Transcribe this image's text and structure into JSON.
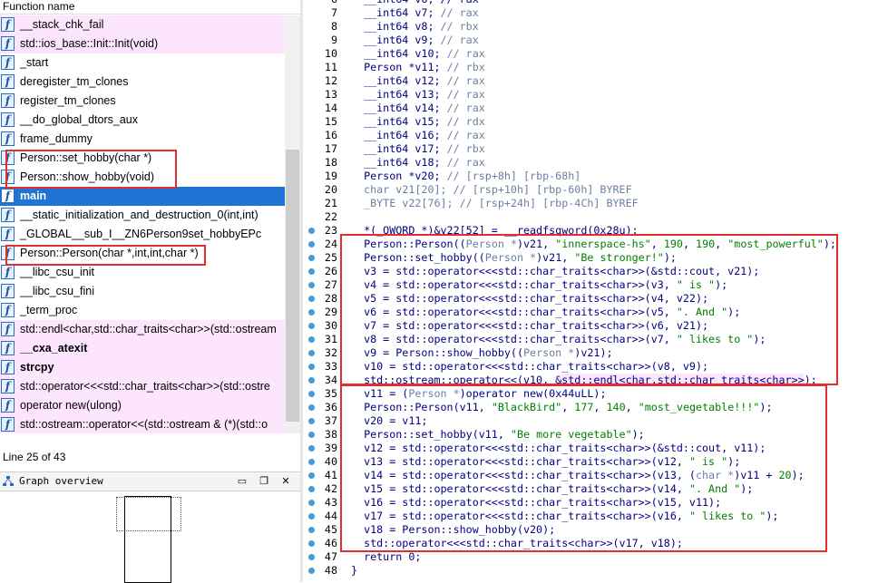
{
  "left_pane": {
    "header": "Function name",
    "functions": [
      {
        "label": "__stack_chk_fail",
        "style": "pink"
      },
      {
        "label": "std::ios_base::Init::Init(void)",
        "style": "pink"
      },
      {
        "label": "_start",
        "style": "normal"
      },
      {
        "label": "deregister_tm_clones",
        "style": "normal"
      },
      {
        "label": "register_tm_clones",
        "style": "normal"
      },
      {
        "label": "__do_global_dtors_aux",
        "style": "normal"
      },
      {
        "label": "frame_dummy",
        "style": "normal"
      },
      {
        "label": "Person::set_hobby(char *)",
        "style": "normal"
      },
      {
        "label": "Person::show_hobby(void)",
        "style": "normal"
      },
      {
        "label": "main",
        "style": "selected"
      },
      {
        "label": "__static_initialization_and_destruction_0(int,int)",
        "style": "normal"
      },
      {
        "label": "_GLOBAL__sub_I__ZN6Person9set_hobbyEPc",
        "style": "normal"
      },
      {
        "label": "Person::Person(char *,int,int,char *)",
        "style": "normal"
      },
      {
        "label": "__libc_csu_init",
        "style": "normal"
      },
      {
        "label": "__libc_csu_fini",
        "style": "normal"
      },
      {
        "label": "_term_proc",
        "style": "normal"
      },
      {
        "label": "std::endl<char,std::char_traits<char>>(std::ostream",
        "style": "pink"
      },
      {
        "label": "__cxa_atexit",
        "style": "pink-bold"
      },
      {
        "label": "strcpy",
        "style": "pink-bold"
      },
      {
        "label": "std::operator<<<std::char_traits<char>>(std::ostre",
        "style": "pink"
      },
      {
        "label": "operator new(ulong)",
        "style": "pink"
      },
      {
        "label": "std::ostream::operator<<(std::ostream & (*)(std::o",
        "style": "pink"
      }
    ],
    "status": "Line 25 of 43",
    "graph_overview_title": "Graph overview"
  },
  "code": {
    "lines": [
      {
        "n": "6",
        "dot": false,
        "t": [
          [
            "  __int64 v6; // rax",
            "pl"
          ]
        ]
      },
      {
        "n": "7",
        "dot": false,
        "t": [
          [
            "  __int64 v7; ",
            "pl"
          ],
          [
            "// rax",
            "cm"
          ]
        ]
      },
      {
        "n": "8",
        "dot": false,
        "t": [
          [
            "  __int64 v8; ",
            "pl"
          ],
          [
            "// rbx",
            "cm"
          ]
        ]
      },
      {
        "n": "9",
        "dot": false,
        "t": [
          [
            "  __int64 v9; ",
            "pl"
          ],
          [
            "// rax",
            "cm"
          ]
        ]
      },
      {
        "n": "10",
        "dot": false,
        "t": [
          [
            "  __int64 v10; ",
            "pl"
          ],
          [
            "// rax",
            "cm"
          ]
        ]
      },
      {
        "n": "11",
        "dot": false,
        "t": [
          [
            "  Person *v11; ",
            "pl"
          ],
          [
            "// rbx",
            "cm"
          ]
        ]
      },
      {
        "n": "12",
        "dot": false,
        "t": [
          [
            "  __int64 v12; ",
            "pl"
          ],
          [
            "// rax",
            "cm"
          ]
        ]
      },
      {
        "n": "13",
        "dot": false,
        "t": [
          [
            "  __int64 v13; ",
            "pl"
          ],
          [
            "// rax",
            "cm"
          ]
        ]
      },
      {
        "n": "14",
        "dot": false,
        "t": [
          [
            "  __int64 v14; ",
            "pl"
          ],
          [
            "// rax",
            "cm"
          ]
        ]
      },
      {
        "n": "15",
        "dot": false,
        "t": [
          [
            "  __int64 v15; ",
            "pl"
          ],
          [
            "// rdx",
            "cm"
          ]
        ]
      },
      {
        "n": "16",
        "dot": false,
        "t": [
          [
            "  __int64 v16; ",
            "pl"
          ],
          [
            "// rax",
            "cm"
          ]
        ]
      },
      {
        "n": "17",
        "dot": false,
        "t": [
          [
            "  __int64 v17; ",
            "pl"
          ],
          [
            "// rbx",
            "cm"
          ]
        ]
      },
      {
        "n": "18",
        "dot": false,
        "t": [
          [
            "  __int64 v18; ",
            "pl"
          ],
          [
            "// rax",
            "cm"
          ]
        ]
      },
      {
        "n": "19",
        "dot": false,
        "t": [
          [
            "  Person *v20; ",
            "pl"
          ],
          [
            "// [rsp+8h] [rbp-68h]",
            "cm"
          ]
        ]
      },
      {
        "n": "20",
        "dot": false,
        "t": [
          [
            "  char v21[20]; ",
            "cm"
          ],
          [
            "// [rsp+10h] [rbp-60h] BYREF",
            "cm"
          ]
        ]
      },
      {
        "n": "21",
        "dot": false,
        "t": [
          [
            "  _BYTE v22[76]; ",
            "cm"
          ],
          [
            "// [rsp+24h] [rbp-4Ch] BYREF",
            "cm"
          ]
        ]
      },
      {
        "n": "22",
        "dot": false,
        "t": [
          [
            "",
            "pl"
          ]
        ]
      },
      {
        "n": "23",
        "dot": true,
        "t": [
          [
            "  *(_QWORD *)&v22[52] = __readfsqword(0x28u);",
            "pl"
          ]
        ]
      },
      {
        "n": "24",
        "dot": true,
        "t": [
          [
            "  Person::Person((",
            "pl"
          ],
          [
            "Person *",
            "cm"
          ],
          [
            ")v21, ",
            "pl"
          ],
          [
            "\"innerspace-hs\"",
            "str"
          ],
          [
            ", ",
            "pl"
          ],
          [
            "190",
            "num"
          ],
          [
            ", ",
            "pl"
          ],
          [
            "190",
            "num"
          ],
          [
            ", ",
            "pl"
          ],
          [
            "\"most_powerful\"",
            "str"
          ],
          [
            ");",
            "pl"
          ]
        ]
      },
      {
        "n": "25",
        "dot": true,
        "t": [
          [
            "  Person::set_hobby((",
            "pl"
          ],
          [
            "Person *",
            "cm"
          ],
          [
            ")v21, ",
            "pl"
          ],
          [
            "\"Be stronger!\"",
            "str"
          ],
          [
            ");",
            "pl"
          ]
        ]
      },
      {
        "n": "26",
        "dot": true,
        "t": [
          [
            "  v3 = std::operator<<<std::char_traits<char>>(&std::cout, v21);",
            "pl"
          ]
        ]
      },
      {
        "n": "27",
        "dot": true,
        "t": [
          [
            "  v4 = std::operator<<<std::char_traits<char>>(v3, ",
            "pl"
          ],
          [
            "\" is \"",
            "str"
          ],
          [
            ");",
            "pl"
          ]
        ]
      },
      {
        "n": "28",
        "dot": true,
        "t": [
          [
            "  v5 = std::operator<<<std::char_traits<char>>(v4, v22);",
            "pl"
          ]
        ]
      },
      {
        "n": "29",
        "dot": true,
        "t": [
          [
            "  v6 = std::operator<<<std::char_traits<char>>(v5, ",
            "pl"
          ],
          [
            "\". And \"",
            "str"
          ],
          [
            ");",
            "pl"
          ]
        ]
      },
      {
        "n": "30",
        "dot": true,
        "t": [
          [
            "  v7 = std::operator<<<std::char_traits<char>>(v6, v21);",
            "pl"
          ]
        ]
      },
      {
        "n": "31",
        "dot": true,
        "t": [
          [
            "  v8 = std::operator<<<std::char_traits<char>>(v7, ",
            "pl"
          ],
          [
            "\" likes to \"",
            "str"
          ],
          [
            ");",
            "pl"
          ]
        ]
      },
      {
        "n": "32",
        "dot": true,
        "t": [
          [
            "  v9 = Person::show_hobby((",
            "pl"
          ],
          [
            "Person *",
            "cm"
          ],
          [
            ")v21);",
            "pl"
          ]
        ]
      },
      {
        "n": "33",
        "dot": true,
        "t": [
          [
            "  v10 = std::operator<<<std::char_traits<char>>(v8, v9);",
            "pl"
          ]
        ]
      },
      {
        "n": "34",
        "dot": true,
        "t": [
          [
            "  std::ostream::operator<<(v10, &",
            "pl"
          ],
          [
            "std::endl<char,std::char_traits<char>>",
            "pink"
          ],
          [
            ");",
            "pl"
          ]
        ]
      },
      {
        "n": "35",
        "dot": true,
        "t": [
          [
            "  v11 = (",
            "pl"
          ],
          [
            "Person *",
            "cm"
          ],
          [
            ")operator new(0x44uLL);",
            "pl"
          ]
        ]
      },
      {
        "n": "36",
        "dot": true,
        "t": [
          [
            "  Person::Person(v11, ",
            "pl"
          ],
          [
            "\"BlackBird\"",
            "str"
          ],
          [
            ", ",
            "pl"
          ],
          [
            "177",
            "num"
          ],
          [
            ", ",
            "pl"
          ],
          [
            "140",
            "num"
          ],
          [
            ", ",
            "pl"
          ],
          [
            "\"most_vegetable!!!\"",
            "str"
          ],
          [
            ");",
            "pl"
          ]
        ]
      },
      {
        "n": "37",
        "dot": true,
        "t": [
          [
            "  v20 = v11;",
            "pl"
          ]
        ]
      },
      {
        "n": "38",
        "dot": true,
        "t": [
          [
            "  Person::set_hobby(v11, ",
            "pl"
          ],
          [
            "\"Be more vegetable\"",
            "str"
          ],
          [
            ");",
            "pl"
          ]
        ]
      },
      {
        "n": "39",
        "dot": true,
        "t": [
          [
            "  v12 = std::operator<<<std::char_traits<char>>(&std::cout, v11);",
            "pl"
          ]
        ]
      },
      {
        "n": "40",
        "dot": true,
        "t": [
          [
            "  v13 = std::operator<<<std::char_traits<char>>(v12, ",
            "pl"
          ],
          [
            "\" is \"",
            "str"
          ],
          [
            ");",
            "pl"
          ]
        ]
      },
      {
        "n": "41",
        "dot": true,
        "t": [
          [
            "  v14 = std::operator<<<std::char_traits<char>>(v13, (",
            "pl"
          ],
          [
            "char *",
            "cm"
          ],
          [
            ")v11 + ",
            "pl"
          ],
          [
            "20",
            "num"
          ],
          [
            ");",
            "pl"
          ]
        ]
      },
      {
        "n": "42",
        "dot": true,
        "t": [
          [
            "  v15 = std::operator<<<std::char_traits<char>>(v14, ",
            "pl"
          ],
          [
            "\". And \"",
            "str"
          ],
          [
            ");",
            "pl"
          ]
        ]
      },
      {
        "n": "43",
        "dot": true,
        "t": [
          [
            "  v16 = std::operator<<<std::char_traits<char>>(v15, v11);",
            "pl"
          ]
        ]
      },
      {
        "n": "44",
        "dot": true,
        "t": [
          [
            "  v17 = std::operator<<<std::char_traits<char>>(v16, ",
            "pl"
          ],
          [
            "\" likes to \"",
            "str"
          ],
          [
            ");",
            "pl"
          ]
        ]
      },
      {
        "n": "45",
        "dot": true,
        "t": [
          [
            "  v18 = Person::show_hobby(v20);",
            "pl"
          ]
        ]
      },
      {
        "n": "46",
        "dot": true,
        "t": [
          [
            "  std::operator<<<std::char_traits<char>>(v17, v18);",
            "pl"
          ]
        ]
      },
      {
        "n": "47",
        "dot": true,
        "t": [
          [
            "  return 0;",
            "pl"
          ]
        ]
      },
      {
        "n": "48",
        "dot": true,
        "t": [
          [
            "}",
            "pl"
          ]
        ]
      }
    ]
  },
  "colors": {
    "selection": "#1e74d4",
    "import_highlight": "#fde6fd",
    "annotation_red": "#e02f2f",
    "string_green": "#008000",
    "code_navy": "#000080"
  }
}
